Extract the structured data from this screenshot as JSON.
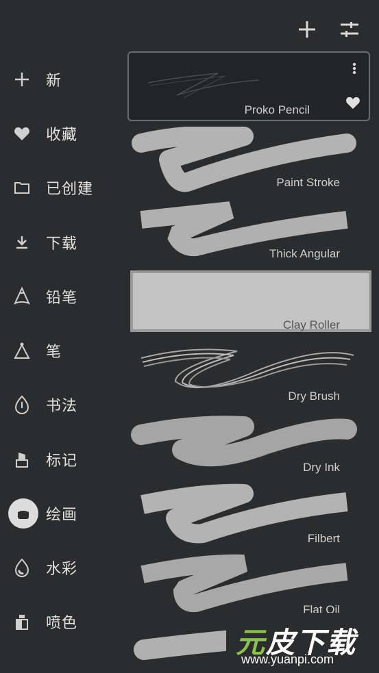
{
  "topbar": {
    "add_icon": "plus-icon",
    "settings_icon": "sliders-icon"
  },
  "sidebar": {
    "items": [
      {
        "label": "新",
        "icon": "plus-icon"
      },
      {
        "label": "收藏",
        "icon": "heart-icon"
      },
      {
        "label": "已创建",
        "icon": "folder-icon"
      },
      {
        "label": "下载",
        "icon": "download-icon"
      },
      {
        "label": "铅笔",
        "icon": "pencil-icon"
      },
      {
        "label": "笔",
        "icon": "pen-icon"
      },
      {
        "label": "书法",
        "icon": "calligraphy-icon"
      },
      {
        "label": "标记",
        "icon": "marker-icon"
      },
      {
        "label": "绘画",
        "icon": "paint-icon",
        "selected": true
      },
      {
        "label": "水彩",
        "icon": "watercolor-icon"
      },
      {
        "label": "喷色",
        "icon": "spray-icon"
      }
    ]
  },
  "brushes": [
    {
      "name": "Proko Pencil",
      "selected": true
    },
    {
      "name": "Paint Stroke"
    },
    {
      "name": "Thick Angular"
    },
    {
      "name": "Clay Roller"
    },
    {
      "name": "Dry Brush"
    },
    {
      "name": "Dry Ink"
    },
    {
      "name": "Filbert"
    },
    {
      "name": "Flat Oil"
    }
  ],
  "watermark": {
    "title_a": "元",
    "title_b": "皮下载",
    "url": "www.yuanpi.com"
  },
  "colors": {
    "background": "#2b2c2e",
    "stroke": "#b5b5b5",
    "text": "#d8d8d8"
  }
}
